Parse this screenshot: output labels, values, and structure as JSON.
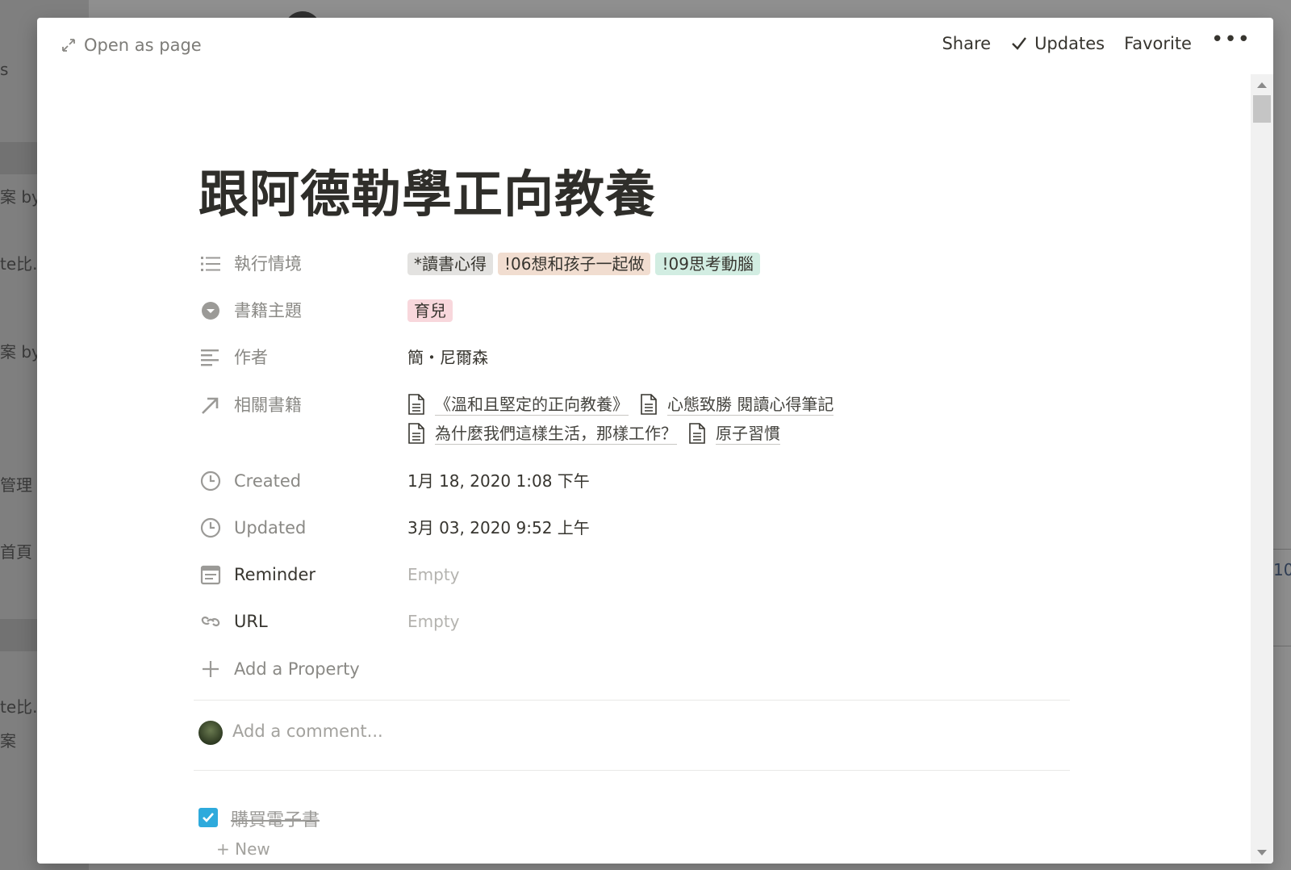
{
  "background": {
    "left_snippets": [
      "s",
      "案 by.",
      "te比..",
      "案 by.",
      "管理",
      "首頁",
      "te比..",
      "案"
    ],
    "right_snippet": "10"
  },
  "topbar": {
    "open_as_page": "Open as page",
    "share": "Share",
    "updates": "Updates",
    "favorite": "Favorite",
    "more": "•••"
  },
  "page": {
    "title": "跟阿德勒學正向教養"
  },
  "properties": {
    "context": {
      "label": "執行情境",
      "icon": "list-icon",
      "tags": [
        {
          "text": "*讀書心得",
          "color": "#e3e2e0"
        },
        {
          "text": "!06想和孩子一起做",
          "color": "#f1ddd0"
        },
        {
          "text": "!09思考動腦",
          "color": "#d2ede2"
        }
      ]
    },
    "topic": {
      "label": "書籍主題",
      "icon": "select-icon",
      "tags": [
        {
          "text": "育兒",
          "color": "#f8d7dc"
        }
      ]
    },
    "author": {
      "label": "作者",
      "icon": "text-icon",
      "value": "簡・尼爾森"
    },
    "related": {
      "label": "相關書籍",
      "icon": "relation-arrow-icon",
      "items": [
        "《溫和且堅定的正向教養》",
        "心態致勝 閱讀心得筆記",
        "為什麼我們這樣生活，那樣工作？",
        "原子習慣"
      ]
    },
    "created": {
      "label": "Created",
      "icon": "clock-icon",
      "value": "1月 18, 2020 1:08 下午"
    },
    "updated": {
      "label": "Updated",
      "icon": "clock-icon",
      "value": "3月 03, 2020 9:52 上午"
    },
    "reminder": {
      "label": "Reminder",
      "icon": "calendar-icon",
      "value": "Empty"
    },
    "url": {
      "label": "URL",
      "icon": "link-icon",
      "value": "Empty"
    },
    "add_property": {
      "label": "Add a Property",
      "icon": "plus-icon"
    }
  },
  "comment": {
    "placeholder": "Add a comment..."
  },
  "todo": {
    "text": "購買電子書",
    "checked": true
  },
  "peek": {
    "text": "+ New"
  }
}
